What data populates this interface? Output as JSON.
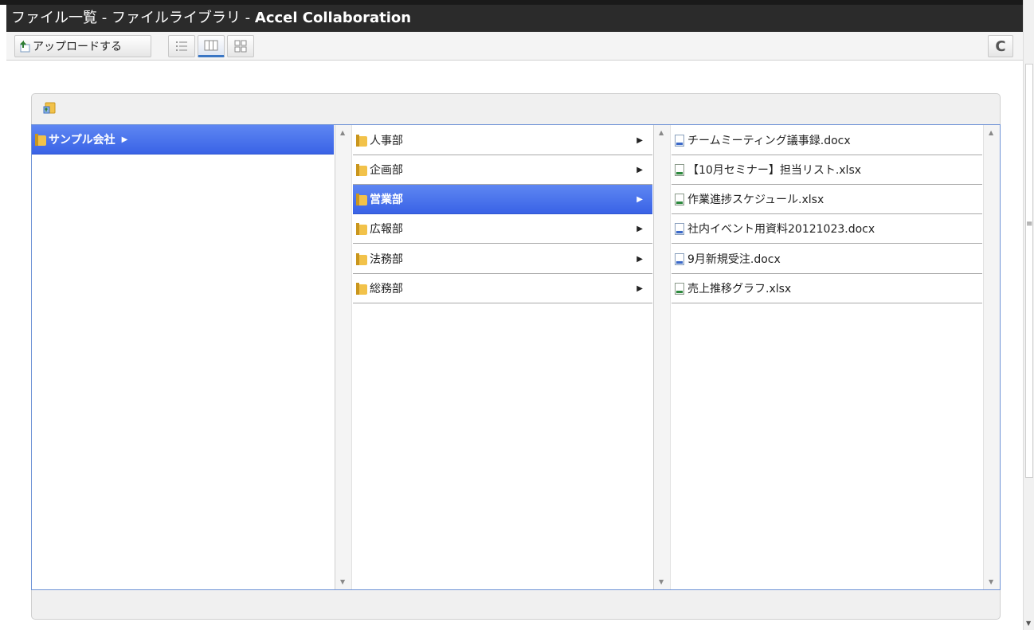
{
  "window": {
    "title_prefix": "ファイル一覧 - ファイルライブラリ - ",
    "title_app": "Accel Collaboration"
  },
  "toolbar": {
    "upload_label": "アップロードする",
    "views": [
      "list-view",
      "column-view",
      "thumbnail-view"
    ],
    "active_view": "column-view",
    "refresh_icon": "C"
  },
  "browser": {
    "column1": [
      {
        "label": "サンプル会社",
        "selected": true
      }
    ],
    "column2": [
      {
        "label": "人事部"
      },
      {
        "label": "企画部"
      },
      {
        "label": "営業部",
        "selected": true
      },
      {
        "label": "広報部"
      },
      {
        "label": "法務部"
      },
      {
        "label": "総務部"
      }
    ],
    "column3": [
      {
        "label": "チームミーティング議事録.docx",
        "type": "docx"
      },
      {
        "label": "【10月セミナー】担当リスト.xlsx",
        "type": "xlsx"
      },
      {
        "label": "作業進捗スケジュール.xlsx",
        "type": "xlsx"
      },
      {
        "label": "社内イベント用資料20121023.docx",
        "type": "docx"
      },
      {
        "label": "9月新規受注.docx",
        "type": "docx"
      },
      {
        "label": "売上推移グラフ.xlsx",
        "type": "xlsx"
      }
    ]
  },
  "colors": {
    "selection": "#4a72ec",
    "title_bg": "#2b2b2b",
    "browser_border": "#6f93d6"
  }
}
